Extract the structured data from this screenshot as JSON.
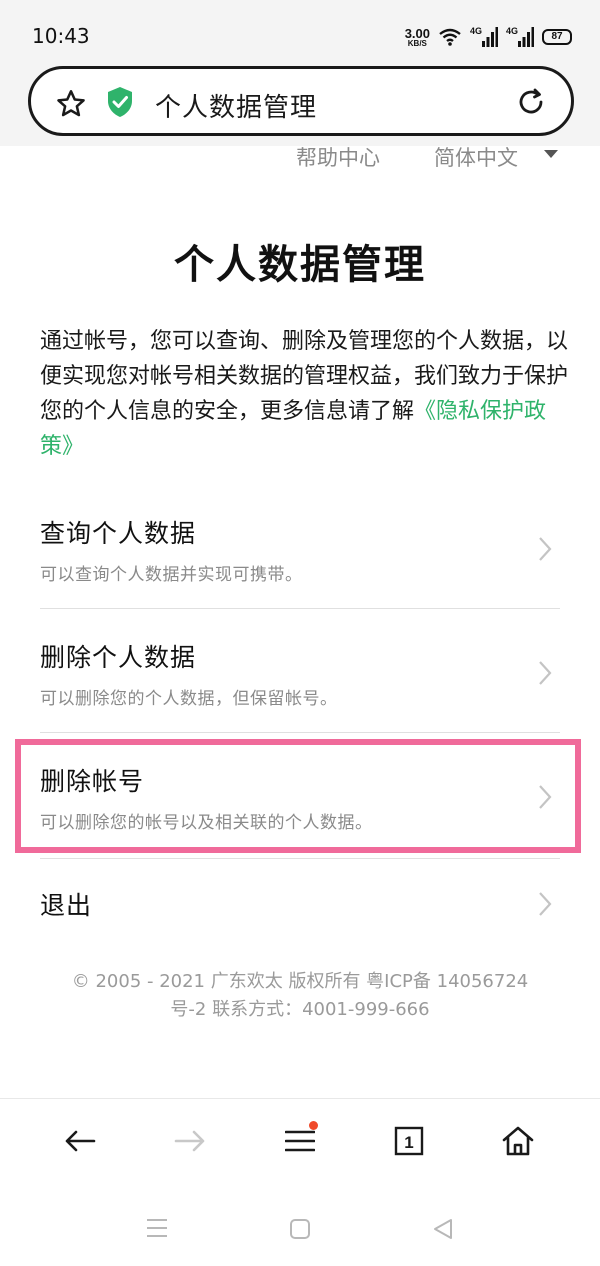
{
  "status_bar": {
    "time": "10:43",
    "net_speed_value": "3.00",
    "net_speed_unit": "KB/S",
    "sim1": "4G",
    "sim2": "4G",
    "battery": "87"
  },
  "url_bar": {
    "title": "个人数据管理"
  },
  "header_links": {
    "help": "帮助中心",
    "language": "简体中文"
  },
  "page": {
    "heading": "个人数据管理",
    "intro": "通过帐号，您可以查询、删除及管理您的个人数据，以便实现您对帐号相关数据的管理权益，我们致力于保护您的个人信息的安全，更多信息请了解",
    "privacy_link": "《隐私保护政策》"
  },
  "menu": [
    {
      "title": "查询个人数据",
      "desc": "可以查询个人数据并实现可携带。"
    },
    {
      "title": "删除个人数据",
      "desc": "可以删除您的个人数据，但保留帐号。"
    },
    {
      "title": "删除帐号",
      "desc": "可以删除您的帐号以及相关联的个人数据。"
    },
    {
      "title": "退出",
      "desc": ""
    }
  ],
  "footer": {
    "line1": "© 2005 - 2021 广东欢太 版权所有 粤ICP备 14056724",
    "line2": "号-2 联系方式：4001-999-666"
  },
  "browser_nav": {
    "tab_count": "1"
  },
  "colors": {
    "accent_green": "#2fb36b",
    "highlight_pink": "#f06a9a",
    "notification_red": "#f04a2a"
  },
  "icons": [
    "star-icon",
    "shield-check-icon",
    "reload-icon",
    "chevron-right-icon",
    "back-arrow-icon",
    "forward-arrow-icon",
    "hamburger-menu-icon",
    "tabs-icon",
    "home-icon",
    "recent-apps-icon",
    "home-square-icon",
    "back-triangle-icon"
  ]
}
